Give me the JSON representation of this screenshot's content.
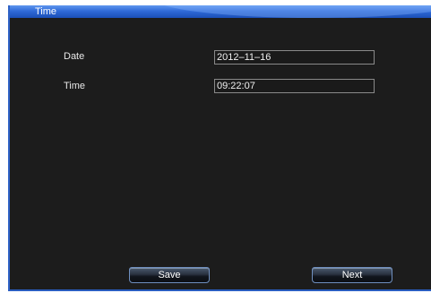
{
  "window": {
    "title": "Time"
  },
  "form": {
    "date_label": "Date",
    "date_value": "2012–11–16",
    "time_label": "Time",
    "time_value": "09:22:07"
  },
  "buttons": {
    "save_label": "Save",
    "next_label": "Next"
  },
  "colors": {
    "titlebar": "#2f6ad8",
    "background": "#1c1c1c",
    "field_border": "#8a8a8a"
  }
}
